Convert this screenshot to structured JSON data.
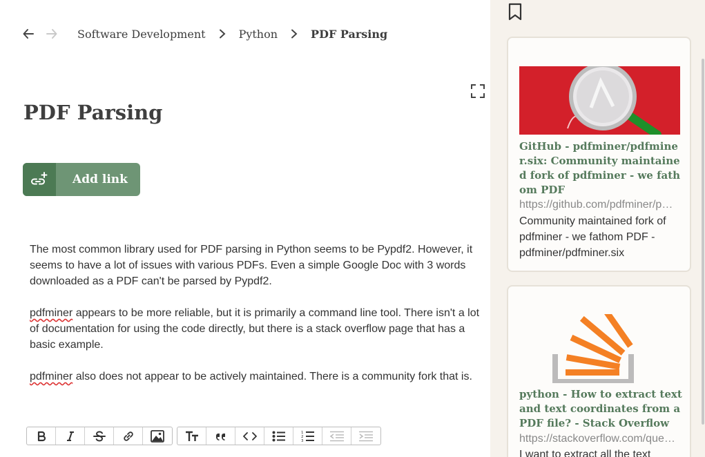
{
  "nav": {
    "back_icon": "arrow-left-icon",
    "forward_icon": "arrow-right-icon",
    "breadcrumbs": [
      "Software Development",
      "Python",
      "PDF Parsing"
    ]
  },
  "page": {
    "title": "PDF Parsing",
    "add_link_label": "Add link",
    "paragraphs": [
      {
        "before": "",
        "term": "",
        "after": "The most common library used for PDF parsing in Python seems to be Pypdf2. However, it seems to have a lot of issues with various PDFs. Even a simple Google Doc with 3 words downloaded as a PDF can't be parsed by Pypdf2."
      },
      {
        "before": "",
        "term": "pdfminer",
        "after": " appears to be more reliable, but it is primarily a command line tool. There isn't a lot of documentation for using the code directly, but there is a stack overflow page that has a basic example."
      },
      {
        "before": "",
        "term": "pdfminer",
        "after": " also does not appear to be actively maintained. There is a community fork that is."
      }
    ]
  },
  "toolbar": {
    "group1": [
      "bold-icon",
      "italic-icon",
      "strikethrough-icon",
      "link-icon",
      "image-icon"
    ],
    "group2": [
      "heading-icon",
      "quote-icon",
      "code-icon",
      "bullet-list-icon",
      "numbered-list-icon",
      "outdent-icon",
      "indent-icon"
    ]
  },
  "links": [
    {
      "title": "GitHub - pdfminer/pdfminer.six: Community maintained fork of pdfminer - we fathom PDF",
      "url": "https://github.com/pdfminer/pdfminer.six",
      "description": "Community maintained fork of pdfminer - we fathom PDF - pdfminer/pdfminer.six"
    },
    {
      "title": "python - How to extract text and text coordinates from a PDF file? - Stack Overflow",
      "url": "https://stackoverflow.com/questions/22898145",
      "description": "I want to extract all the text"
    }
  ],
  "colors": {
    "accent_green": "#557a5c",
    "button_green": "#6e9575",
    "button_green_dark": "#4c7a54",
    "panel_bg": "#f6f2ec",
    "so_orange": "#f48024"
  }
}
